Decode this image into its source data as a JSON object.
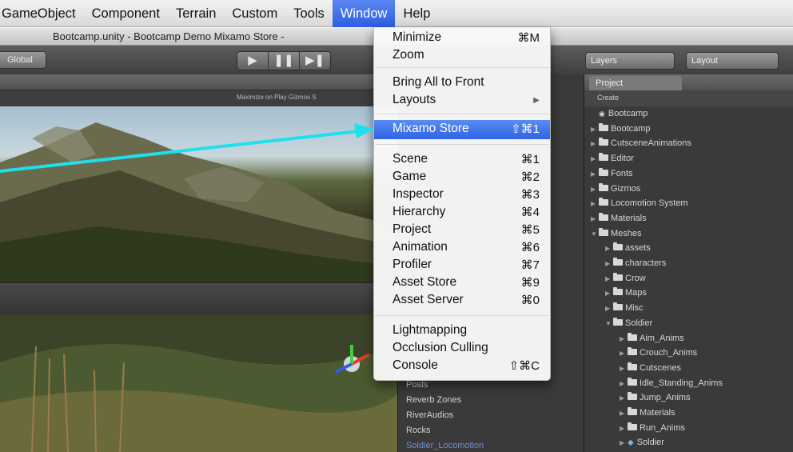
{
  "menubar": {
    "items": [
      {
        "label": "GameObject"
      },
      {
        "label": "Component"
      },
      {
        "label": "Terrain"
      },
      {
        "label": "Custom"
      },
      {
        "label": "Tools"
      },
      {
        "label": "Window"
      },
      {
        "label": "Help"
      }
    ],
    "active": "Window"
  },
  "window": {
    "title": "Bootcamp.unity - Bootcamp Demo Mixamo Store -"
  },
  "toolbar": {
    "global_label": "Global",
    "play_icons": [
      "▶",
      "❚❚",
      "▶❚"
    ],
    "layers_label": "Layers",
    "layout_label": "Layout"
  },
  "scene": {
    "subbar_label": "Maximize on Play  Gizmos  S"
  },
  "hierarchy": {
    "items": [
      "Posts",
      "Reverb Zones",
      "RiverAudios",
      "Rocks",
      "Soldier_Locomotion"
    ]
  },
  "project": {
    "tab_label": "Project",
    "create_label": "Create",
    "rows": [
      {
        "label": "Bootcamp",
        "indent": 0,
        "kind": "scene"
      },
      {
        "label": "Bootcamp",
        "indent": 0,
        "kind": "folder"
      },
      {
        "label": "CutsceneAnimations",
        "indent": 0,
        "kind": "folder"
      },
      {
        "label": "Editor",
        "indent": 0,
        "kind": "folder"
      },
      {
        "label": "Fonts",
        "indent": 0,
        "kind": "folder"
      },
      {
        "label": "Gizmos",
        "indent": 0,
        "kind": "folder"
      },
      {
        "label": "Locomotion System",
        "indent": 0,
        "kind": "folder"
      },
      {
        "label": "Materials",
        "indent": 0,
        "kind": "folder"
      },
      {
        "label": "Meshes",
        "indent": 0,
        "kind": "folder-open"
      },
      {
        "label": "assets",
        "indent": 1,
        "kind": "folder"
      },
      {
        "label": "characters",
        "indent": 1,
        "kind": "folder"
      },
      {
        "label": "Crow",
        "indent": 1,
        "kind": "folder"
      },
      {
        "label": "Maps",
        "indent": 1,
        "kind": "folder"
      },
      {
        "label": "Misc",
        "indent": 1,
        "kind": "folder"
      },
      {
        "label": "Soldier",
        "indent": 1,
        "kind": "folder-open"
      },
      {
        "label": "Aim_Anims",
        "indent": 2,
        "kind": "folder"
      },
      {
        "label": "Crouch_Anims",
        "indent": 2,
        "kind": "folder"
      },
      {
        "label": "Cutscenes",
        "indent": 2,
        "kind": "folder"
      },
      {
        "label": "Idle_Standing_Anims",
        "indent": 2,
        "kind": "folder"
      },
      {
        "label": "Jump_Anims",
        "indent": 2,
        "kind": "folder"
      },
      {
        "label": "Materials",
        "indent": 2,
        "kind": "folder"
      },
      {
        "label": "Run_Anims",
        "indent": 2,
        "kind": "folder"
      },
      {
        "label": "Soldier",
        "indent": 2,
        "kind": "prefab"
      }
    ]
  },
  "window_menu": {
    "items": [
      {
        "label": "Minimize",
        "shortcut": "⌘M"
      },
      {
        "label": "Zoom",
        "shortcut": ""
      },
      {
        "label": "Bring All to Front",
        "shortcut": ""
      },
      {
        "label": "Layouts",
        "shortcut": "▶"
      },
      {
        "label": "Mixamo Store",
        "shortcut": "⇧⌘1",
        "highlighted": true
      },
      {
        "label": "Scene",
        "shortcut": "⌘1"
      },
      {
        "label": "Game",
        "shortcut": "⌘2"
      },
      {
        "label": "Inspector",
        "shortcut": "⌘3"
      },
      {
        "label": "Hierarchy",
        "shortcut": "⌘4"
      },
      {
        "label": "Project",
        "shortcut": "⌘5"
      },
      {
        "label": "Animation",
        "shortcut": "⌘6"
      },
      {
        "label": "Profiler",
        "shortcut": "⌘7"
      },
      {
        "label": "Asset Store",
        "shortcut": "⌘9"
      },
      {
        "label": "Asset Server",
        "shortcut": "⌘0"
      },
      {
        "label": "Lightmapping",
        "shortcut": ""
      },
      {
        "label": "Occlusion Culling",
        "shortcut": ""
      },
      {
        "label": "Console",
        "shortcut": "⇧⌘C"
      }
    ]
  },
  "colors": {
    "highlight": "#2f63e3",
    "annotation_arrow": "#1ee0ee"
  }
}
